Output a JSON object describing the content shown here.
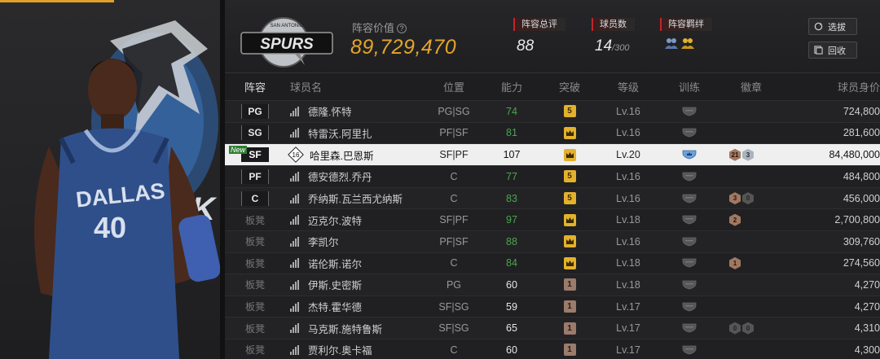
{
  "header": {
    "lineup_value_label": "阵容价值",
    "lineup_value": "89,729,470",
    "team_logo_text": "SPURS",
    "team_logo_arc": "SAN ANTONIO",
    "stats": {
      "rating_label": "阵容总评",
      "rating_value": "88",
      "players_label": "球员数",
      "players_value": "14",
      "players_max": "/300",
      "synergy_label": "阵容羁绊"
    },
    "buttons": {
      "select": "选拔",
      "recycle": "回收"
    }
  },
  "player_art": {
    "jersey_team": "DALLAS",
    "jersey_number": "40",
    "logo_text": "ICK"
  },
  "table": {
    "columns": {
      "lineup": "阵容",
      "name": "球员名",
      "position": "位置",
      "overall": "能力",
      "breakthrough": "突破",
      "level": "等级",
      "training": "训练",
      "badges": "徽章",
      "price": "球员身价"
    },
    "rows": [
      {
        "slot": "PG",
        "name": "德隆.怀特",
        "pos": "PG|SG",
        "ovr": "74",
        "ovr_color": "green",
        "brk": "5",
        "brk_type": "gold",
        "lv": "Lv.16",
        "badges": [],
        "price": "724,800"
      },
      {
        "slot": "SG",
        "name": "特雷沃.阿里扎",
        "pos": "PF|SF",
        "ovr": "81",
        "ovr_color": "green",
        "brk": "crown",
        "brk_type": "gold",
        "lv": "Lv.16",
        "badges": [],
        "price": "281,600"
      },
      {
        "slot": "SF",
        "tag": "New",
        "num": "16",
        "name": "哈里森.巴恩斯",
        "pos": "SF|PF",
        "ovr": "107",
        "ovr_color": "dark",
        "brk": "crown",
        "brk_type": "gold",
        "lv": "Lv.20",
        "train": "active",
        "badges": [
          {
            "v": "21",
            "t": "br"
          },
          {
            "v": "3",
            "t": "sv"
          }
        ],
        "price": "84,480,000",
        "selected": true
      },
      {
        "slot": "PF",
        "name": "德安德烈.乔丹",
        "pos": "C",
        "ovr": "77",
        "ovr_color": "green",
        "brk": "5",
        "brk_type": "gold",
        "lv": "Lv.16",
        "badges": [],
        "price": "484,800"
      },
      {
        "slot": "C",
        "name": "乔纳斯.瓦兰西尤纳斯",
        "pos": "C",
        "ovr": "83",
        "ovr_color": "green",
        "brk": "5",
        "brk_type": "gold",
        "lv": "Lv.16",
        "badges": [
          {
            "v": "3",
            "t": "br"
          },
          {
            "v": "0",
            "t": "gr"
          }
        ],
        "price": "456,000"
      },
      {
        "slot": "板凳",
        "name": "迈克尔.波特",
        "pos": "SF|PF",
        "ovr": "97",
        "ovr_color": "green",
        "brk": "crown",
        "brk_type": "gold",
        "lv": "Lv.18",
        "badges": [
          {
            "v": "2",
            "t": "br"
          }
        ],
        "price": "2,700,800"
      },
      {
        "slot": "板凳",
        "name": "李凯尔",
        "pos": "PF|SF",
        "ovr": "88",
        "ovr_color": "green",
        "brk": "crown",
        "brk_type": "gold",
        "lv": "Lv.16",
        "badges": [],
        "price": "309,760"
      },
      {
        "slot": "板凳",
        "name": "诺伦斯.诺尔",
        "pos": "C",
        "ovr": "84",
        "ovr_color": "green",
        "brk": "crown",
        "brk_type": "gold",
        "lv": "Lv.18",
        "badges": [
          {
            "v": "1",
            "t": "br"
          }
        ],
        "price": "274,560"
      },
      {
        "slot": "板凳",
        "name": "伊斯.史密斯",
        "pos": "PG",
        "ovr": "60",
        "ovr_color": "white",
        "brk": "1",
        "brk_type": "bronze",
        "lv": "Lv.18",
        "badges": [],
        "price": "4,270"
      },
      {
        "slot": "板凳",
        "name": "杰特.霍华德",
        "pos": "SF|SG",
        "ovr": "59",
        "ovr_color": "white",
        "brk": "1",
        "brk_type": "bronze",
        "lv": "Lv.17",
        "badges": [],
        "price": "4,270"
      },
      {
        "slot": "板凳",
        "name": "马克斯.施特鲁斯",
        "pos": "SF|SG",
        "ovr": "65",
        "ovr_color": "white",
        "brk": "1",
        "brk_type": "bronze",
        "lv": "Lv.17",
        "badges": [
          {
            "v": "0",
            "t": "gr"
          },
          {
            "v": "0",
            "t": "gr"
          }
        ],
        "price": "4,310"
      },
      {
        "slot": "板凳",
        "name": "贾利尔.奥卡福",
        "pos": "C",
        "ovr": "60",
        "ovr_color": "white",
        "brk": "1",
        "brk_type": "bronze",
        "lv": "Lv.17",
        "badges": [],
        "price": "4,300"
      }
    ]
  },
  "colors": {
    "accent_gold": "#e3a52a",
    "green": "#4aa64e",
    "red_tag": "#c0262c"
  }
}
